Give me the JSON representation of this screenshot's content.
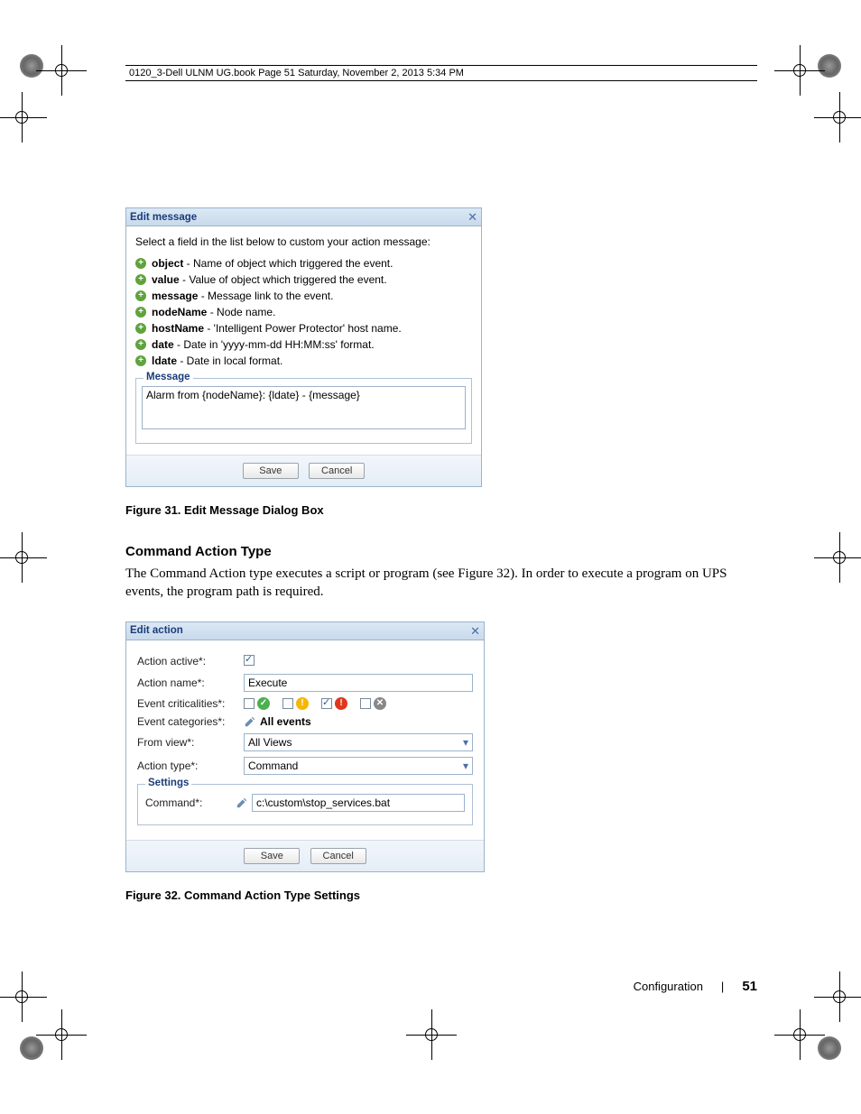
{
  "header": {
    "book_line": "0120_3-Dell ULNM UG.book  Page 51  Saturday, November 2, 2013  5:34 PM"
  },
  "dialog1": {
    "title": "Edit message",
    "instruction": "Select a field in the list below to custom your action message:",
    "fields": {
      "object": {
        "name": "object",
        "desc": " - Name of object which triggered the event."
      },
      "value": {
        "name": "value",
        "desc": " - Value of object which triggered the event."
      },
      "message": {
        "name": "message",
        "desc": " - Message link to the event."
      },
      "nodeName": {
        "name": "nodeName",
        "desc": " - Node name."
      },
      "hostName": {
        "name": "hostName",
        "desc": " - 'Intelligent Power Protector' host name."
      },
      "date": {
        "name": "date",
        "desc": " - Date in 'yyyy-mm-dd HH:MM:ss' format."
      },
      "ldate": {
        "name": "ldate",
        "desc": " - Date in local format."
      }
    },
    "message_legend": "Message",
    "message_value": "Alarm from {nodeName}: {ldate} - {message}",
    "save": "Save",
    "cancel": "Cancel"
  },
  "captions": {
    "fig31": "Figure 31.  Edit Message Dialog Box",
    "fig32": "Figure 32.  Command Action Type Settings"
  },
  "section": {
    "heading": "Command Action Type",
    "paragraph": "The Command Action type executes a script or program (see Figure 32). In order to execute a program on UPS events, the program path is required."
  },
  "dialog2": {
    "title": "Edit action",
    "labels": {
      "active": "Action active*:",
      "name": "Action name*:",
      "crit": "Event criticalities*:",
      "cat": "Event categories*:",
      "view": "From view*:",
      "type": "Action type*:",
      "command": "Command*:"
    },
    "values": {
      "name": "Execute",
      "cat": "All events",
      "view": "All Views",
      "type": "Command",
      "command": "c:\\custom\\stop_services.bat"
    },
    "settings_legend": "Settings",
    "save": "Save",
    "cancel": "Cancel"
  },
  "footer": {
    "section": "Configuration",
    "page": "51"
  }
}
